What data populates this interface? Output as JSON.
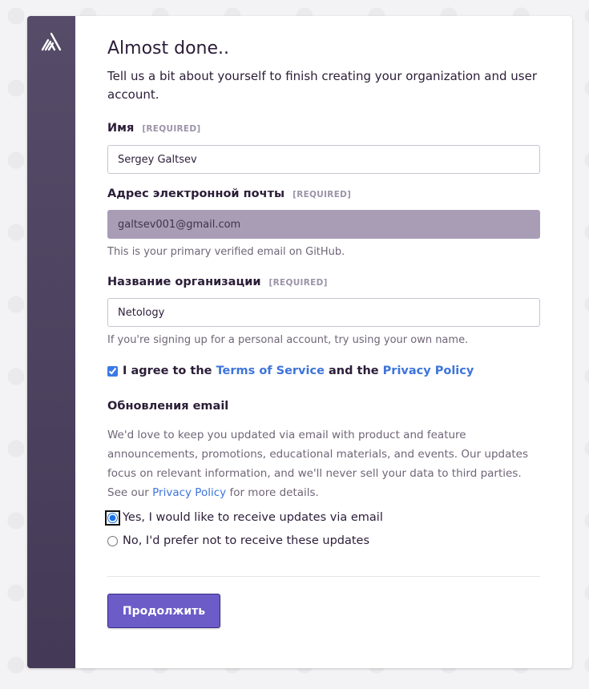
{
  "header": {
    "title": "Almost done..",
    "subtitle": "Tell us a bit about yourself to finish creating your organization and user account."
  },
  "fields": {
    "name": {
      "label": "Имя",
      "required": "[REQUIRED]",
      "value": "Sergey Galtsev"
    },
    "email": {
      "label": "Адрес электронной почты",
      "required": "[REQUIRED]",
      "value": "galtsev001@gmail.com",
      "help": "This is your primary verified email on GitHub."
    },
    "org": {
      "label": "Название организации",
      "required": "[REQUIRED]",
      "value": "Netology",
      "help": "If you're signing up for a personal account, try using your own name."
    }
  },
  "agreement": {
    "prefix": "I agree to the",
    "terms": "Terms of Service",
    "middle": "and the",
    "privacy": "Privacy Policy",
    "checked": true
  },
  "updates": {
    "title": "Обновления email",
    "text_before": "We'd love to keep you updated via email with product and feature announcements, promotions, educational materials, and events. Our updates focus on relevant information, and we'll never sell your data to third parties. See our",
    "privacy_link": "Privacy Policy",
    "text_after": "for more details.",
    "yes": "Yes, I would like to receive updates via email",
    "no": "No, I'd prefer not to receive these updates",
    "selected": "yes"
  },
  "actions": {
    "continue": "Продолжить"
  },
  "icons": {
    "logo": "sentry-logo-icon"
  },
  "colors": {
    "rail": "#4f4562",
    "button": "#6b5cc8",
    "link": "#3d74db",
    "disabled_field": "#a99db6"
  }
}
